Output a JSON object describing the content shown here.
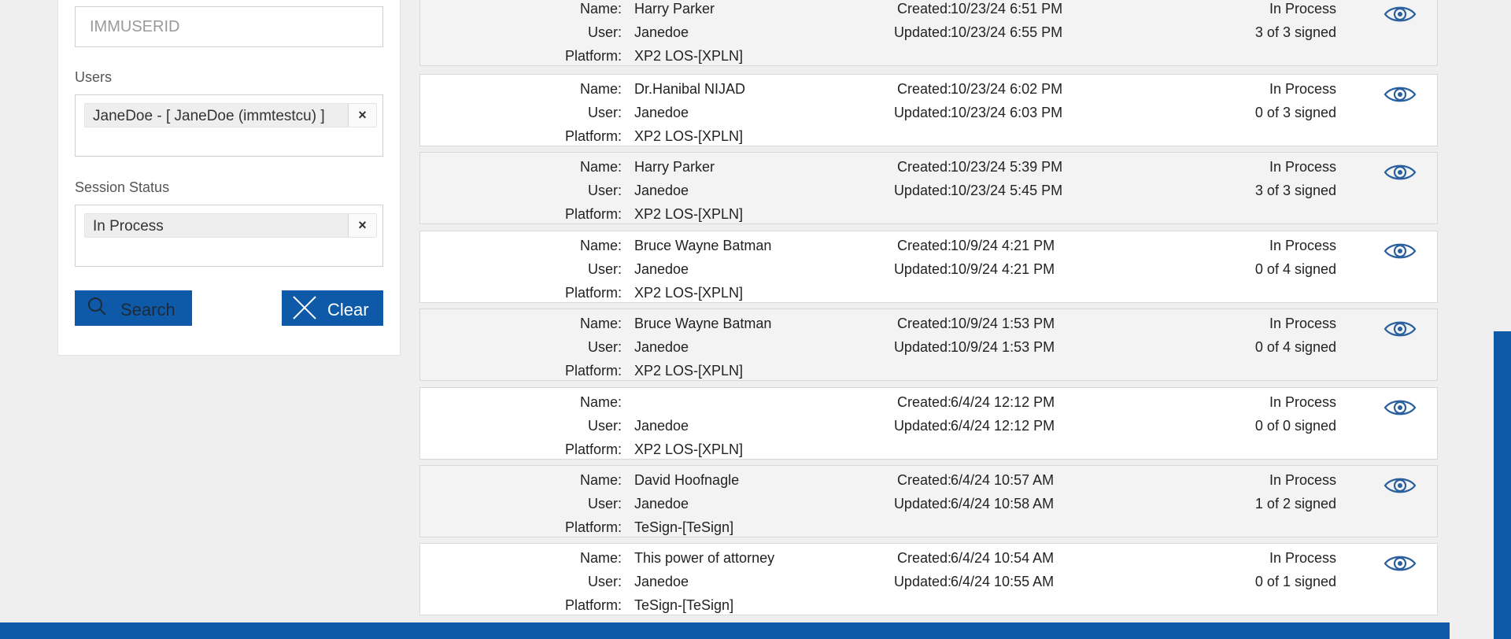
{
  "filters": {
    "userid_placeholder": "IMMUSERID",
    "users_label": "Users",
    "users_chip": "JaneDoe - [ JaneDoe (immtestcu) ]",
    "status_label": "Session Status",
    "status_chip": "In Process",
    "chip_remove_glyph": "×",
    "search_label": "Search",
    "clear_label": "Clear"
  },
  "labels": {
    "name": "Name:",
    "user": "User:",
    "platform": "Platform:",
    "created": "Created:",
    "updated": "Updated:"
  },
  "sessions": [
    {
      "name": "Harry Parker",
      "user": "Janedoe",
      "platform": "XP2 LOS-[XPLN]",
      "created": "10/23/24 6:51 PM",
      "updated": "10/23/24 6:55 PM",
      "status": "In Process",
      "signed": "3 of 3 signed"
    },
    {
      "name": "Dr.Hanibal NIJAD",
      "user": "Janedoe",
      "platform": "XP2 LOS-[XPLN]",
      "created": "10/23/24 6:02 PM",
      "updated": "10/23/24 6:03 PM",
      "status": "In Process",
      "signed": "0 of 3 signed"
    },
    {
      "name": "Harry Parker",
      "user": "Janedoe",
      "platform": "XP2 LOS-[XPLN]",
      "created": "10/23/24 5:39 PM",
      "updated": "10/23/24 5:45 PM",
      "status": "In Process",
      "signed": "3 of 3 signed"
    },
    {
      "name": "Bruce Wayne Batman",
      "user": "Janedoe",
      "platform": "XP2 LOS-[XPLN]",
      "created": "10/9/24 4:21 PM",
      "updated": "10/9/24 4:21 PM",
      "status": "In Process",
      "signed": "0 of 4 signed"
    },
    {
      "name": "Bruce Wayne Batman",
      "user": "Janedoe",
      "platform": "XP2 LOS-[XPLN]",
      "created": "10/9/24 1:53 PM",
      "updated": "10/9/24 1:53 PM",
      "status": "In Process",
      "signed": "0 of 4 signed"
    },
    {
      "name": "",
      "user": "Janedoe",
      "platform": "XP2 LOS-[XPLN]",
      "created": "6/4/24 12:12 PM",
      "updated": "6/4/24 12:12 PM",
      "status": "In Process",
      "signed": "0 of 0 signed"
    },
    {
      "name": "David Hoofnagle",
      "user": "Janedoe",
      "platform": "TeSign-[TeSign]",
      "created": "6/4/24 10:57 AM",
      "updated": "6/4/24 10:58 AM",
      "status": "In Process",
      "signed": "1 of 2 signed"
    },
    {
      "name": "This power of attorney",
      "user": "Janedoe",
      "platform": "TeSign-[TeSign]",
      "created": "6/4/24 10:54 AM",
      "updated": "6/4/24 10:55 AM",
      "status": "In Process",
      "signed": "0 of 1 signed"
    }
  ],
  "colors": {
    "accent": "#0e5aa8",
    "icon": "#2a5f9e",
    "row_alt": "#f3f3f3"
  },
  "icons": {
    "view": "eye-icon",
    "search": "search-icon",
    "clear": "close-icon"
  }
}
